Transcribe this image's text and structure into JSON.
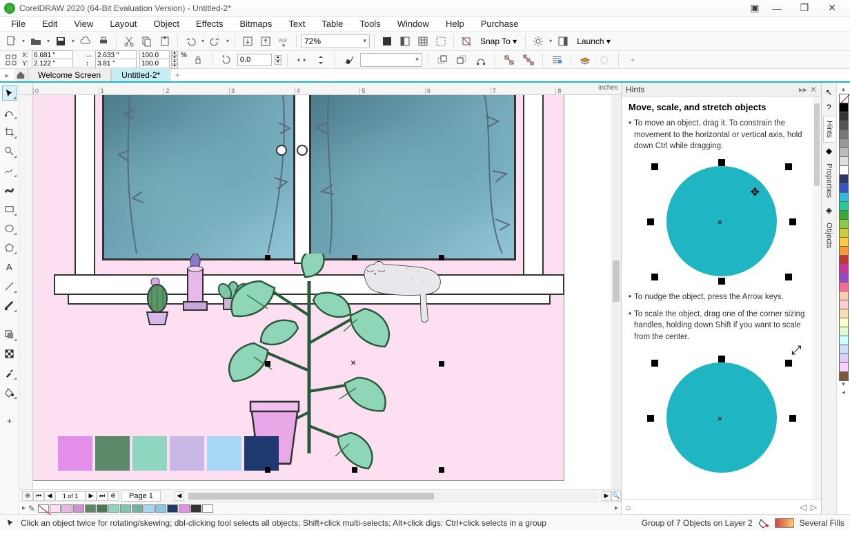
{
  "title": "CorelDRAW 2020 (64-Bit Evaluation Version) - Untitled-2*",
  "menu": [
    "File",
    "Edit",
    "View",
    "Layout",
    "Object",
    "Effects",
    "Bitmaps",
    "Text",
    "Table",
    "Tools",
    "Window",
    "Help",
    "Purchase"
  ],
  "toolbar1": {
    "zoom": "72%",
    "snap": "Snap To",
    "launch": "Launch"
  },
  "propbar": {
    "x": "6.681 \"",
    "y": "2.122 \"",
    "w": "2.633 \"",
    "h": "3.81 \"",
    "sx": "100.0",
    "sy": "100.0",
    "unit": "%",
    "rot": "0.0"
  },
  "tabs": {
    "welcome": "Welcome Screen",
    "doc": "Untitled-2*"
  },
  "ruler": {
    "units": "inches",
    "marks": [
      "0",
      "1",
      "2",
      "3",
      "4",
      "5",
      "6",
      "7",
      "8"
    ]
  },
  "pageNav": {
    "count": "1 of 1",
    "page": "Page 1"
  },
  "swatches": [
    "#e38ee8",
    "#5a8868",
    "#8fd5c0",
    "#c9b8e6",
    "#a6d8f5",
    "#1e3a6e"
  ],
  "hints": {
    "title": "Hints",
    "heading": "Move, scale, and stretch objects",
    "b1": "To move an object, drag it. To constrain the movement to the horizontal or vertical axis, hold down Ctrl while dragging.",
    "b2": "To nudge the object, press the Arrow keys.",
    "b3": "To scale the object, drag one of the corner sizing handles, holding down Shift if you want to scale from the center."
  },
  "rightDock": {
    "t1": "Hints",
    "t2": "Properties",
    "t3": "Objects"
  },
  "dockColors": [
    "#ffffff",
    "#000000",
    "#333333",
    "#555555",
    "#777777",
    "#999999",
    "#bbbbbb",
    "#dddddd",
    "#7a5a3a",
    "#ff9933",
    "#ffcc33",
    "#ffff33",
    "#88cc44",
    "#33aa33",
    "#22ccbb",
    "#22aadd",
    "#2255cc",
    "#5544aa",
    "#9944cc",
    "#cc3399",
    "#cc3355",
    "#ff6699",
    "#ffccaa",
    "#ffcccc",
    "#ffddaa",
    "#ffffcc",
    "#ddffcc"
  ],
  "docPalette": [
    "#fce0f2",
    "#e6b8e0",
    "#d090d8",
    "#5a8868",
    "#4a7858",
    "#8fd5c0",
    "#7fc5b0",
    "#6fb5a0",
    "#a6d8f5",
    "#86c8e5",
    "#1e3a6e",
    "#e38ee8",
    "#333333",
    "#ffffff"
  ],
  "status": {
    "hint": "Click an object twice for rotating/skewing; dbl-clicking tool selects all objects; Shift+click multi-selects; Alt+click digs; Ctrl+click selects in a group",
    "sel": "Group of 7 Objects on Layer 2",
    "fill": "Several Fills"
  }
}
